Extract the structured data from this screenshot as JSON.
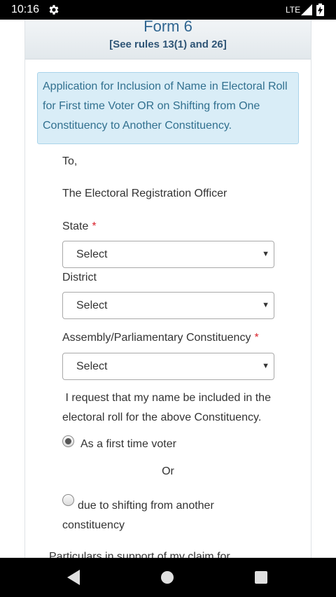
{
  "status_bar": {
    "time": "10:16",
    "network": "LTE",
    "icons": [
      "gear-icon",
      "signal-icon",
      "battery-icon"
    ]
  },
  "form": {
    "title": "Form 6",
    "rules": "[See rules 13(1) and 26]",
    "info": "Application for Inclusion of Name in Electoral Roll for First time Voter OR on Shifting from One Constituency to Another Constituency.",
    "to": "To,",
    "officer": "The Electoral Registration Officer",
    "state": {
      "label": "State",
      "required": "*",
      "value": "Select"
    },
    "district": {
      "label": "District",
      "value": "Select"
    },
    "constituency": {
      "label": "Assembly/Parliamentary Constituency",
      "required": "*",
      "value": "Select"
    },
    "request": "I request that my name be included in the electoral roll for the above Constituency.",
    "option_first_time": "As a first time voter",
    "option_first_time_selected": true,
    "or": "Or",
    "option_shifting": "due to shifting from another constituency",
    "option_shifting_selected": false,
    "particulars_partial": "Particulars in support of my claim for"
  },
  "nav_bar": {
    "icons": [
      "back-icon",
      "home-icon",
      "recents-icon"
    ]
  },
  "colors": {
    "title_blue": "#2f6590",
    "info_bg": "#d9edf7",
    "info_text": "#31708f",
    "required_red": "#d9232d"
  }
}
